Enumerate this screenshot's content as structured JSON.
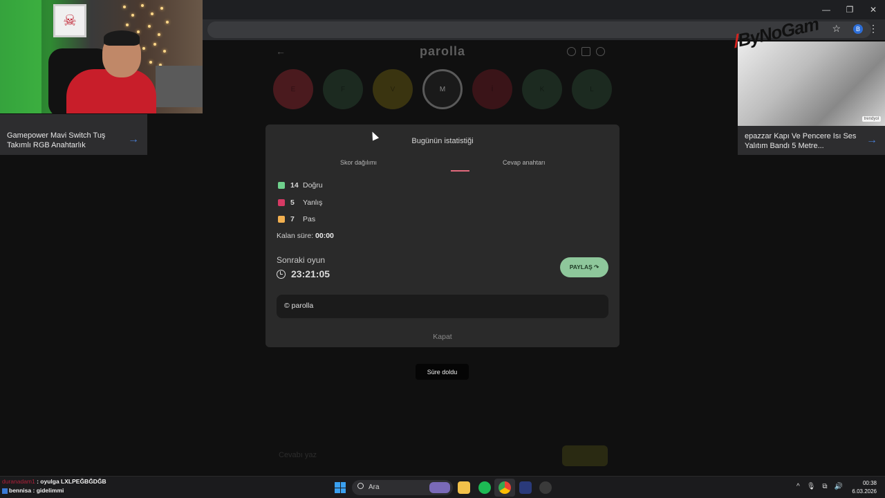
{
  "game": {
    "logo": "parolla",
    "letters": [
      {
        "char": "E",
        "color": "#4a1a1e"
      },
      {
        "char": "F",
        "color": "#1c2a20"
      },
      {
        "char": "V",
        "color": "#3a3410"
      },
      {
        "char": "M",
        "color": "#1a1a1a"
      },
      {
        "char": "İ",
        "color": "#3a1418"
      },
      {
        "char": "K",
        "color": "#1c2a20"
      },
      {
        "char": "L",
        "color": "#1c2a20"
      }
    ],
    "answer_placeholder": "Cevabı yaz",
    "answer_button": "Ver"
  },
  "modal": {
    "title": "Bugünün istatistiği",
    "tabs": [
      "Skor dağılımı",
      "Cevap anahtarı"
    ],
    "stats": [
      {
        "count": "14",
        "label": "Doğru",
        "color": "#6fd08c"
      },
      {
        "count": "5",
        "label": "Yanlış",
        "color": "#d63a64"
      },
      {
        "count": "7",
        "label": "Pas",
        "color": "#f2b050"
      }
    ],
    "remaining_label": "Kalan süre:",
    "remaining_value": "00:00",
    "next_label": "Sonraki oyun",
    "next_time": "23:21:05",
    "share_label": "PAYLAŞ ↷",
    "copyright": "© parolla",
    "close_label": "Kapat"
  },
  "toast": "Süre doldu",
  "ads": {
    "left_text": "Gamepower Mavi Switch Tuş Takımlı RGB Anahtarlık",
    "right_text": "epazzar Kapı Ve Pencere Isı Ses Yalıtım Bandı 5 Metre...",
    "right_badge": "trendyol",
    "arrow": "→"
  },
  "watermark": {
    "prefix": "/",
    "text": "ByNoGam"
  },
  "webcam_logo": "☠",
  "chat": [
    {
      "user": "duranadam1",
      "message": "oyulga LXLPEĞBĞDĞB",
      "user_color": "#b0203a"
    },
    {
      "user": "bennisa",
      "message": "gidelimmi",
      "user_color": "#f2f2f2"
    }
  ],
  "taskbar": {
    "search_label": "Ara",
    "time": "00:38",
    "date": "6.03.2026",
    "tray_icons": [
      "^",
      "🎙",
      "⧉",
      "🔊"
    ]
  },
  "browser": {
    "window_controls": [
      "—",
      "❐",
      "✕"
    ],
    "star": "☆",
    "profile": "B",
    "menu": "⋮"
  }
}
